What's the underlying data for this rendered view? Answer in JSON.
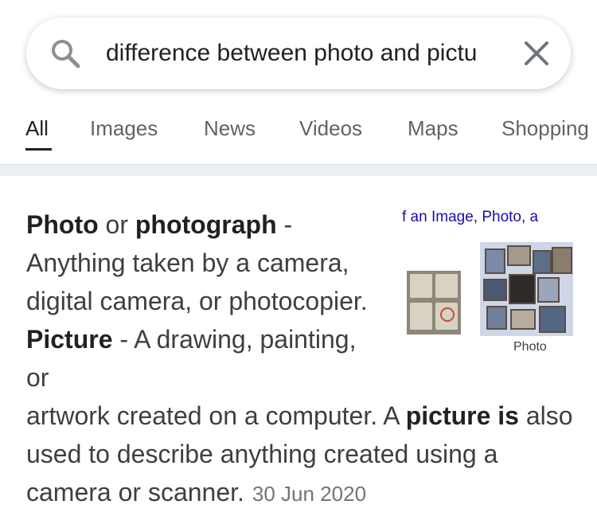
{
  "search": {
    "query": "difference between photo and pictu",
    "search_icon": "search-icon",
    "clear_icon": "close-icon"
  },
  "tabs": [
    {
      "label": "All",
      "active": true
    },
    {
      "label": "Images",
      "active": false
    },
    {
      "label": "News",
      "active": false
    },
    {
      "label": "Videos",
      "active": false
    },
    {
      "label": "Maps",
      "active": false
    },
    {
      "label": "Shopping",
      "active": false
    }
  ],
  "answer": {
    "term1": "Photo",
    "t1": " or ",
    "term2": "photograph",
    "t2": " - Anything taken by a camera, digital camera, or photocopier. ",
    "term3": "Picture",
    "t3": " - A drawing, painting, or",
    "t4": "artwork created on a computer. A ",
    "term4": "picture is",
    "t5": " also used to describe anything created using a camera or scanner.",
    "date": "30 Jun 2020"
  },
  "thumbnail": {
    "title": "f an Image, Photo, a",
    "caption": "Photo"
  },
  "colors": {
    "link": "#1a0dab",
    "text": "#202124",
    "secondary": "#5f6368"
  }
}
